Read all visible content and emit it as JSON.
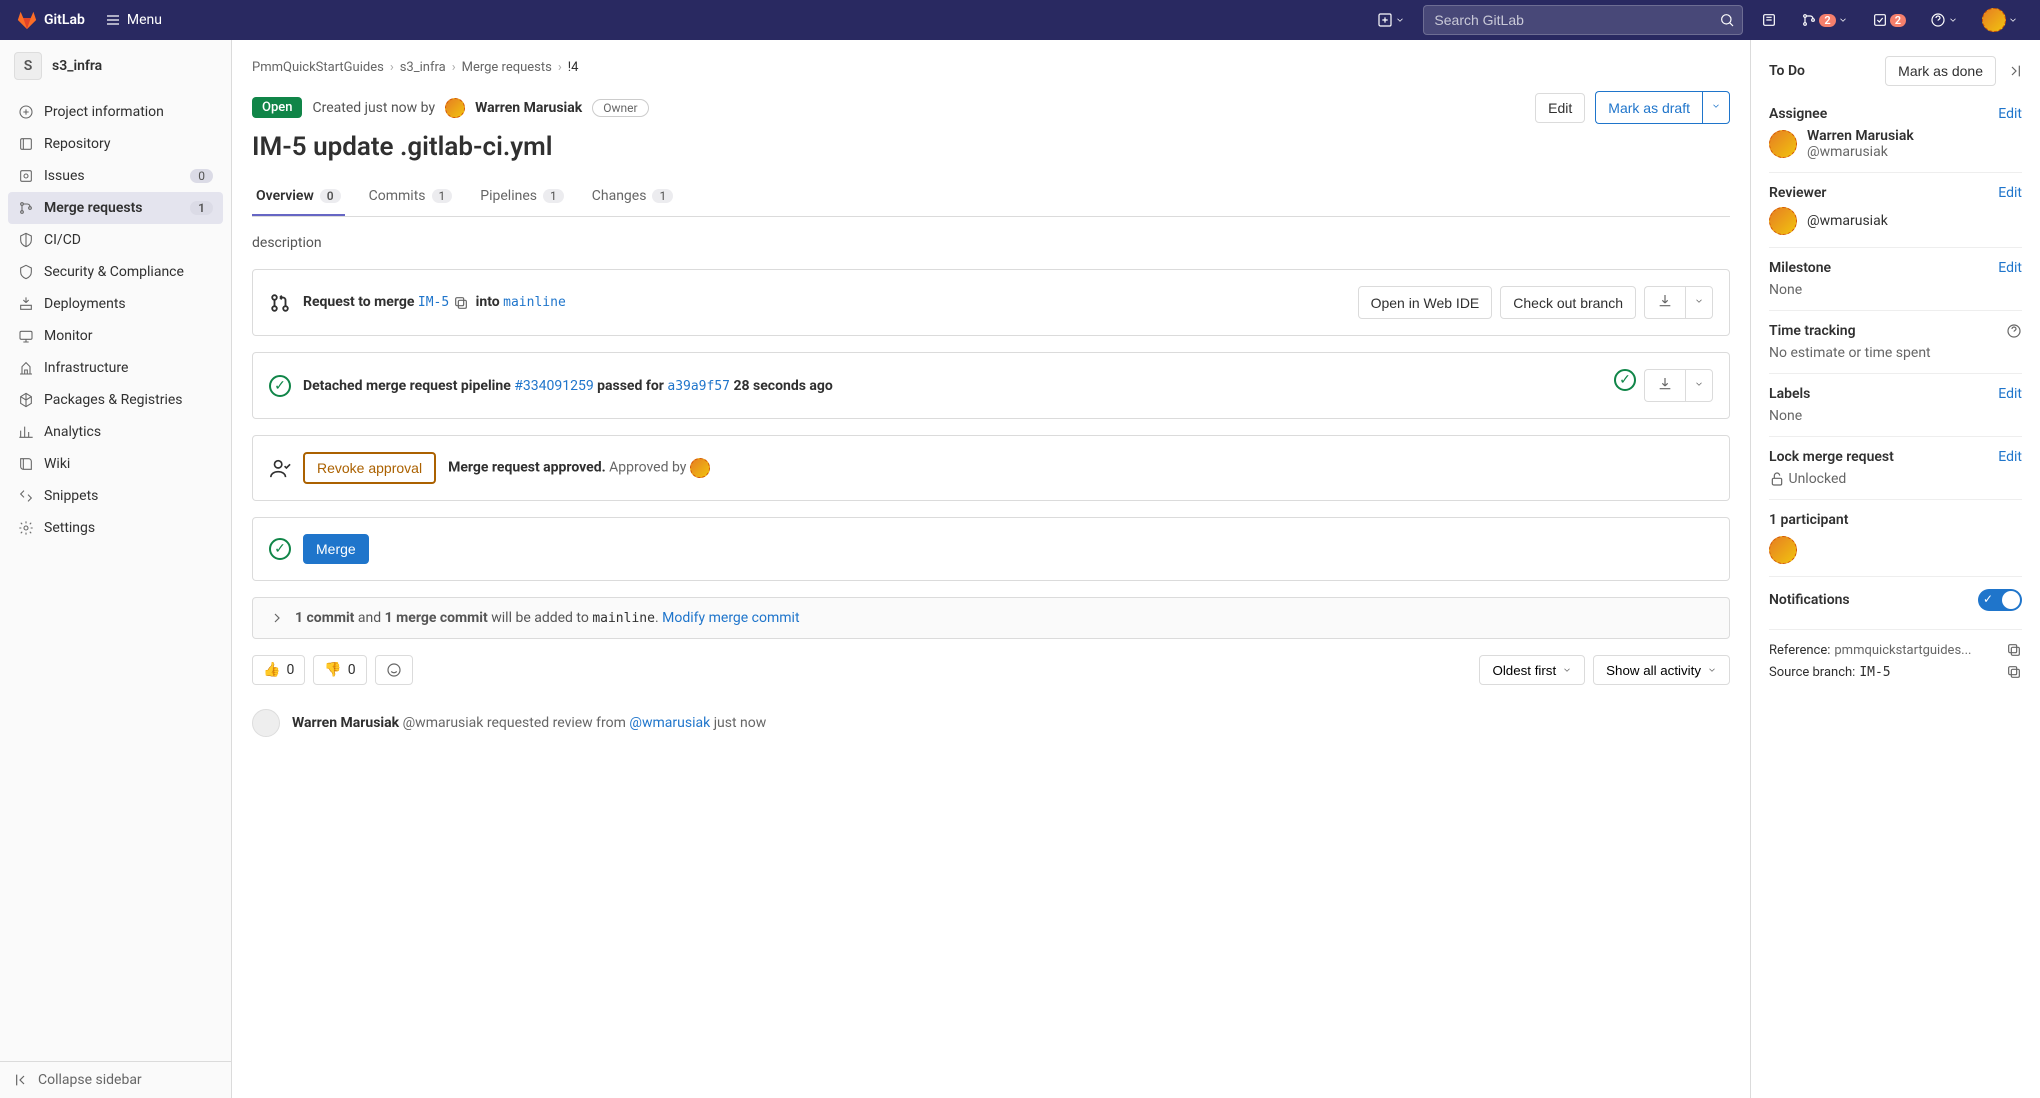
{
  "topnav": {
    "brand": "GitLab",
    "menu_label": "Menu",
    "search_placeholder": "Search GitLab",
    "mr_badge": "2",
    "todo_badge": "2"
  },
  "sidebar": {
    "project_initial": "S",
    "project_name": "s3_infra",
    "items": [
      {
        "label": "Project information"
      },
      {
        "label": "Repository"
      },
      {
        "label": "Issues",
        "count": "0"
      },
      {
        "label": "Merge requests",
        "count": "1",
        "active": true
      },
      {
        "label": "CI/CD"
      },
      {
        "label": "Security & Compliance"
      },
      {
        "label": "Deployments"
      },
      {
        "label": "Monitor"
      },
      {
        "label": "Infrastructure"
      },
      {
        "label": "Packages & Registries"
      },
      {
        "label": "Analytics"
      },
      {
        "label": "Wiki"
      },
      {
        "label": "Snippets"
      },
      {
        "label": "Settings"
      }
    ],
    "collapse_label": "Collapse sidebar"
  },
  "breadcrumbs": {
    "items": [
      "PmmQuickStartGuides",
      "s3_infra",
      "Merge requests",
      "!4"
    ]
  },
  "mr": {
    "status": "Open",
    "created_prefix": "Created just now by",
    "author": "Warren Marusiak",
    "owner_badge": "Owner",
    "edit_btn": "Edit",
    "draft_btn": "Mark as draft",
    "title": "IM-5 update .gitlab-ci.yml",
    "tabs": [
      {
        "label": "Overview",
        "count": "0",
        "active": true
      },
      {
        "label": "Commits",
        "count": "1"
      },
      {
        "label": "Pipelines",
        "count": "1"
      },
      {
        "label": "Changes",
        "count": "1"
      }
    ],
    "description": "description",
    "merge_request": {
      "text": "Request to merge",
      "source": "IM-5",
      "into": "into",
      "target": "mainline",
      "open_ide": "Open in Web IDE",
      "checkout": "Check out branch"
    },
    "pipeline": {
      "prefix": "Detached merge request pipeline",
      "id": "#334091259",
      "mid": "passed for",
      "sha": "a39a9f57",
      "suffix": "28 seconds ago"
    },
    "approval": {
      "revoke_btn": "Revoke approval",
      "approved_text": "Merge request approved.",
      "approved_by": "Approved by"
    },
    "merge_btn": "Merge",
    "commit_footer": {
      "bold1": "1 commit",
      "mid1": "and",
      "bold2": "1 merge commit",
      "mid2": "will be added to",
      "target": "mainline",
      "dot": ".",
      "modify_link": "Modify merge commit"
    },
    "reactions": {
      "thumbs_up": "0",
      "thumbs_down": "0"
    },
    "filters": {
      "sort": "Oldest first",
      "activity": "Show all activity"
    },
    "activity": {
      "author": "Warren Marusiak",
      "handle1": "@wmarusiak",
      "mid": "requested review from",
      "handle2": "@wmarusiak",
      "time": "just now"
    }
  },
  "right": {
    "todo_label": "To Do",
    "mark_done": "Mark as done",
    "assignee": {
      "label": "Assignee",
      "edit": "Edit",
      "name": "Warren Marusiak",
      "handle": "@wmarusiak"
    },
    "reviewer": {
      "label": "Reviewer",
      "edit": "Edit",
      "handle": "@wmarusiak"
    },
    "milestone": {
      "label": "Milestone",
      "edit": "Edit",
      "value": "None"
    },
    "time": {
      "label": "Time tracking",
      "value": "No estimate or time spent"
    },
    "labels": {
      "label": "Labels",
      "edit": "Edit",
      "value": "None"
    },
    "lock": {
      "label": "Lock merge request",
      "edit": "Edit",
      "value": "Unlocked"
    },
    "participants": "1 participant",
    "notifications": "Notifications",
    "reference": {
      "label": "Reference:",
      "value": "pmmquickstartguides..."
    },
    "source": {
      "label": "Source branch:",
      "value": "IM-5"
    }
  }
}
